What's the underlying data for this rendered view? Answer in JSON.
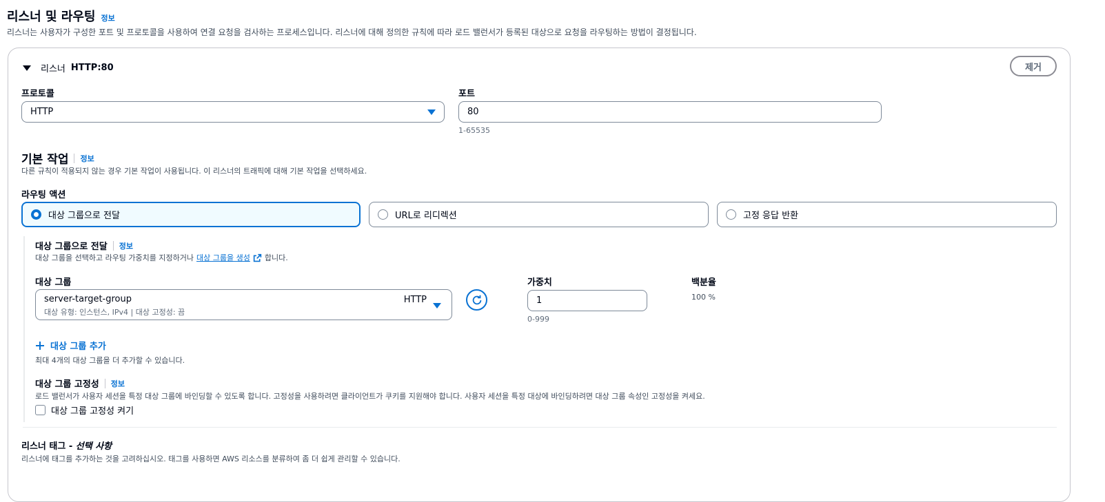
{
  "section": {
    "title": "리스너 및 라우팅",
    "info": "정보",
    "description": "리스너는 사용자가 구성한 포트 및 프로토콜을 사용하여 연결 요청을 검사하는 프로세스입니다. 리스너에 대해 정의한 규칙에 따라 로드 밸런서가 등록된 대상으로 요청을 라우팅하는 방법이 결정됩니다."
  },
  "listener": {
    "label": "리스너",
    "value": "HTTP:80",
    "remove_button": "제거",
    "protocol_label": "프로토콜",
    "protocol_value": "HTTP",
    "port_label": "포트",
    "port_value": "80",
    "port_hint": "1-65535"
  },
  "default_action": {
    "title": "기본 작업",
    "info": "정보",
    "description": "다른 규칙이 적용되지 않는 경우 기본 작업이 사용됩니다. 이 리스너의 트래픽에 대해 기본 작업을 선택하세요.",
    "routing_label": "라우팅 액션",
    "options": [
      "대상 그룹으로 전달",
      "URL로 리디렉션",
      "고정 응답 반환"
    ],
    "selected_index": 0
  },
  "forward": {
    "title": "대상 그룹으로 전달",
    "info": "정보",
    "description_pre": "대상 그룹을 선택하고 라우팅 가중치를 지정하거나",
    "description_link": "대상 그룹을 생성",
    "description_post": "합니다.",
    "target_group_label": "대상 그룹",
    "target_group_name": "server-target-group",
    "target_group_protocol": "HTTP",
    "target_group_meta": "대상 유형: 인스턴스, IPv4 | 대상 고정성: 끔",
    "weight_label": "가중치",
    "weight_value": "1",
    "weight_hint": "0-999",
    "percent_label": "백분율",
    "percent_value": "100 %",
    "add_group": "대상 그룹 추가",
    "add_group_hint": "최대 4개의 대상 그룹을 더 추가할 수 있습니다."
  },
  "stickiness": {
    "title": "대상 그룹 고정성",
    "info": "정보",
    "description": "로드 밸런서가 사용자 세션을 특정 대상 그룹에 바인딩할 수 있도록 합니다. 고정성을 사용하려면 클라이언트가 쿠키를 지원해야 합니다. 사용자 세션을 특정 대상에 바인딩하려면 대상 그룹 속성인 고정성을 켜세요.",
    "checkbox_label": "대상 그룹 고정성 켜기"
  },
  "tags": {
    "title": "리스너 태그 - ",
    "title_optional": "선택 사항",
    "description": "리스너에 태그를 추가하는 것을 고려하십시오. 태그를 사용하면 AWS 리소스를 분류하여 좀 더 쉽게 관리할 수 있습니다."
  },
  "colors": {
    "accent": "#0972d3",
    "border": "#7d8998",
    "text": "#000716",
    "muted": "#5f6b7a"
  },
  "icons": [
    "caret-down-icon",
    "select-caret-icon",
    "refresh-icon",
    "plus-icon",
    "external-link-icon",
    "radio-icon",
    "checkbox-icon"
  ]
}
